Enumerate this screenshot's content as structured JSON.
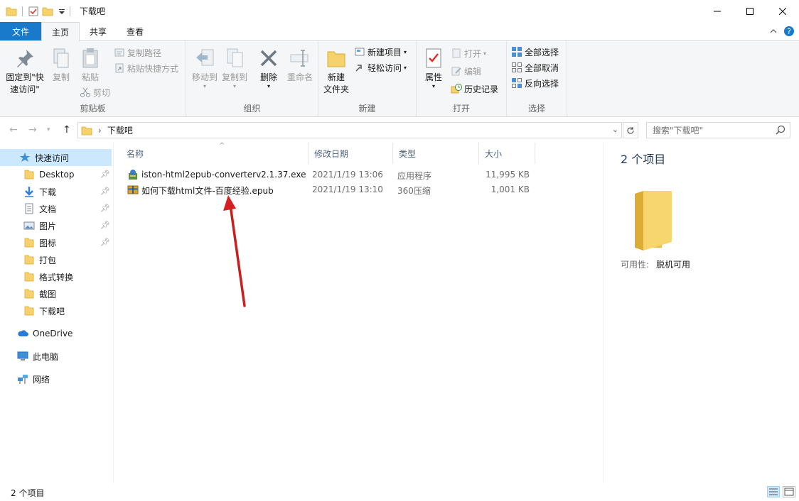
{
  "window": {
    "title": "下载吧",
    "controls": [
      "minimize-icon",
      "maximize-icon",
      "close-icon"
    ]
  },
  "ribbon_tabs": [
    {
      "label": "文件"
    },
    {
      "label": "主页"
    },
    {
      "label": "共享"
    },
    {
      "label": "查看"
    }
  ],
  "ribbon": {
    "clipboard": {
      "pin_label_1": "固定到\"快",
      "pin_label_2": "速访问\"",
      "copy": "复制",
      "paste": "粘贴",
      "copy_path": "复制路径",
      "paste_shortcut": "粘贴快捷方式",
      "cut": "剪切",
      "group": "剪贴板"
    },
    "organize": {
      "move_to": "移动到",
      "copy_to": "复制到",
      "delete": "删除",
      "rename": "重命名",
      "group": "组织"
    },
    "new": {
      "new_folder_1": "新建",
      "new_folder_2": "文件夹",
      "new_item": "新建项目",
      "easy_access": "轻松访问",
      "group": "新建"
    },
    "open": {
      "properties": "属性",
      "open": "打开",
      "edit": "编辑",
      "history": "历史记录",
      "group": "打开"
    },
    "select": {
      "select_all": "全部选择",
      "select_none": "全部取消",
      "invert": "反向选择",
      "group": "选择"
    }
  },
  "address": {
    "path": "下载吧",
    "search_placeholder": "搜索\"下载吧\""
  },
  "nav": {
    "quick_access": "快速访问",
    "items": [
      {
        "label": "Desktop",
        "pinned": true,
        "icon": "folder-icon"
      },
      {
        "label": "下载",
        "pinned": true,
        "icon": "download-icon"
      },
      {
        "label": "文档",
        "pinned": true,
        "icon": "document-icon"
      },
      {
        "label": "图片",
        "pinned": true,
        "icon": "pictures-icon"
      },
      {
        "label": "图标",
        "pinned": true,
        "icon": "folder-icon"
      },
      {
        "label": "打包",
        "pinned": false,
        "icon": "folder-icon"
      },
      {
        "label": "格式转换",
        "pinned": false,
        "icon": "folder-icon"
      },
      {
        "label": "截图",
        "pinned": false,
        "icon": "folder-icon"
      },
      {
        "label": "下载吧",
        "pinned": false,
        "icon": "folder-icon"
      }
    ],
    "onedrive": "OneDrive",
    "this_pc": "此电脑",
    "network": "网络"
  },
  "columns": {
    "name": "名称",
    "date": "修改日期",
    "type": "类型",
    "size": "大小"
  },
  "files": [
    {
      "name": "iston-html2epub-converterv2.1.37.exe",
      "date": "2021/1/19 13:06",
      "type": "应用程序",
      "size": "11,995 KB",
      "icon": "installer-icon"
    },
    {
      "name": "如何下载html文件-百度经验.epub",
      "date": "2021/1/19 13:10",
      "type": "360压缩",
      "size": "1,001 KB",
      "icon": "archive-icon"
    }
  ],
  "details": {
    "count": "2 个项目",
    "availability_label": "可用性:",
    "availability_value": "脱机可用"
  },
  "status": {
    "count": "2 个项目"
  },
  "colors": {
    "file_tab": "#1979ca",
    "selection": "#cce8ff",
    "folder": "#f5d26b",
    "arrow": "#d42020"
  }
}
